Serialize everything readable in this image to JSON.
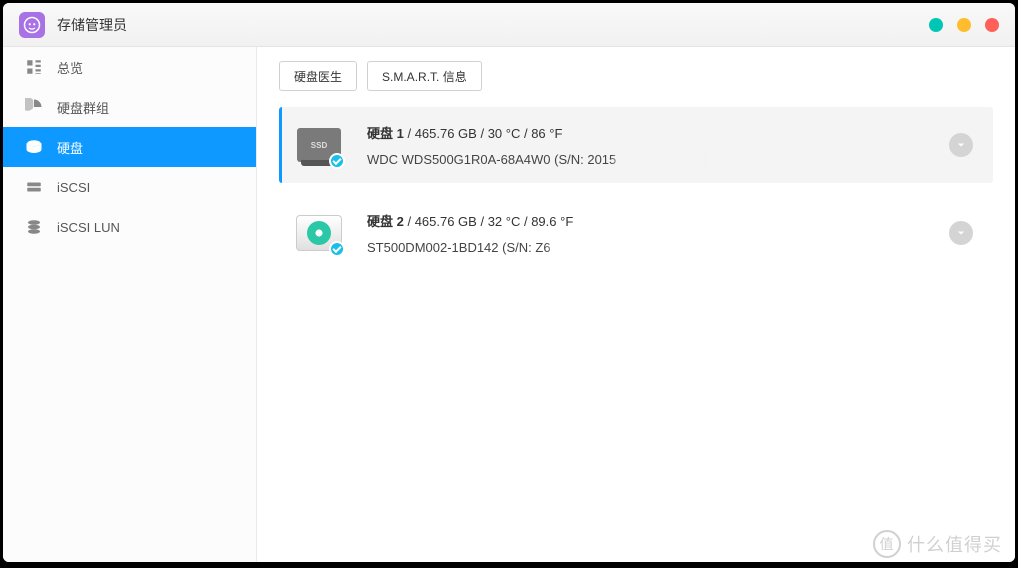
{
  "window": {
    "title": "存储管理员"
  },
  "sidebar": {
    "items": [
      {
        "label": "总览"
      },
      {
        "label": "硬盘群组"
      },
      {
        "label": "硬盘"
      },
      {
        "label": "iSCSI"
      },
      {
        "label": "iSCSI LUN"
      }
    ]
  },
  "toolbar": {
    "doctor": "硬盘医生",
    "smart": "S.M.A.R.T. 信息"
  },
  "disks": [
    {
      "name": "硬盘 1",
      "capacity": "465.76 GB",
      "temp_c": "30 °C",
      "temp_f": "86 °F",
      "model": "WDC WDS500G1R0A-68A4W0",
      "sn_prefix": "(S/N: 2015",
      "type": "ssd"
    },
    {
      "name": "硬盘 2",
      "capacity": "465.76 GB",
      "temp_c": "32 °C",
      "temp_f": "89.6 °F",
      "model": "ST500DM002-1BD142",
      "sn_prefix": "(S/N: Z6",
      "type": "hdd"
    }
  ],
  "watermark": {
    "text": "什么值得买",
    "badge": "值"
  }
}
